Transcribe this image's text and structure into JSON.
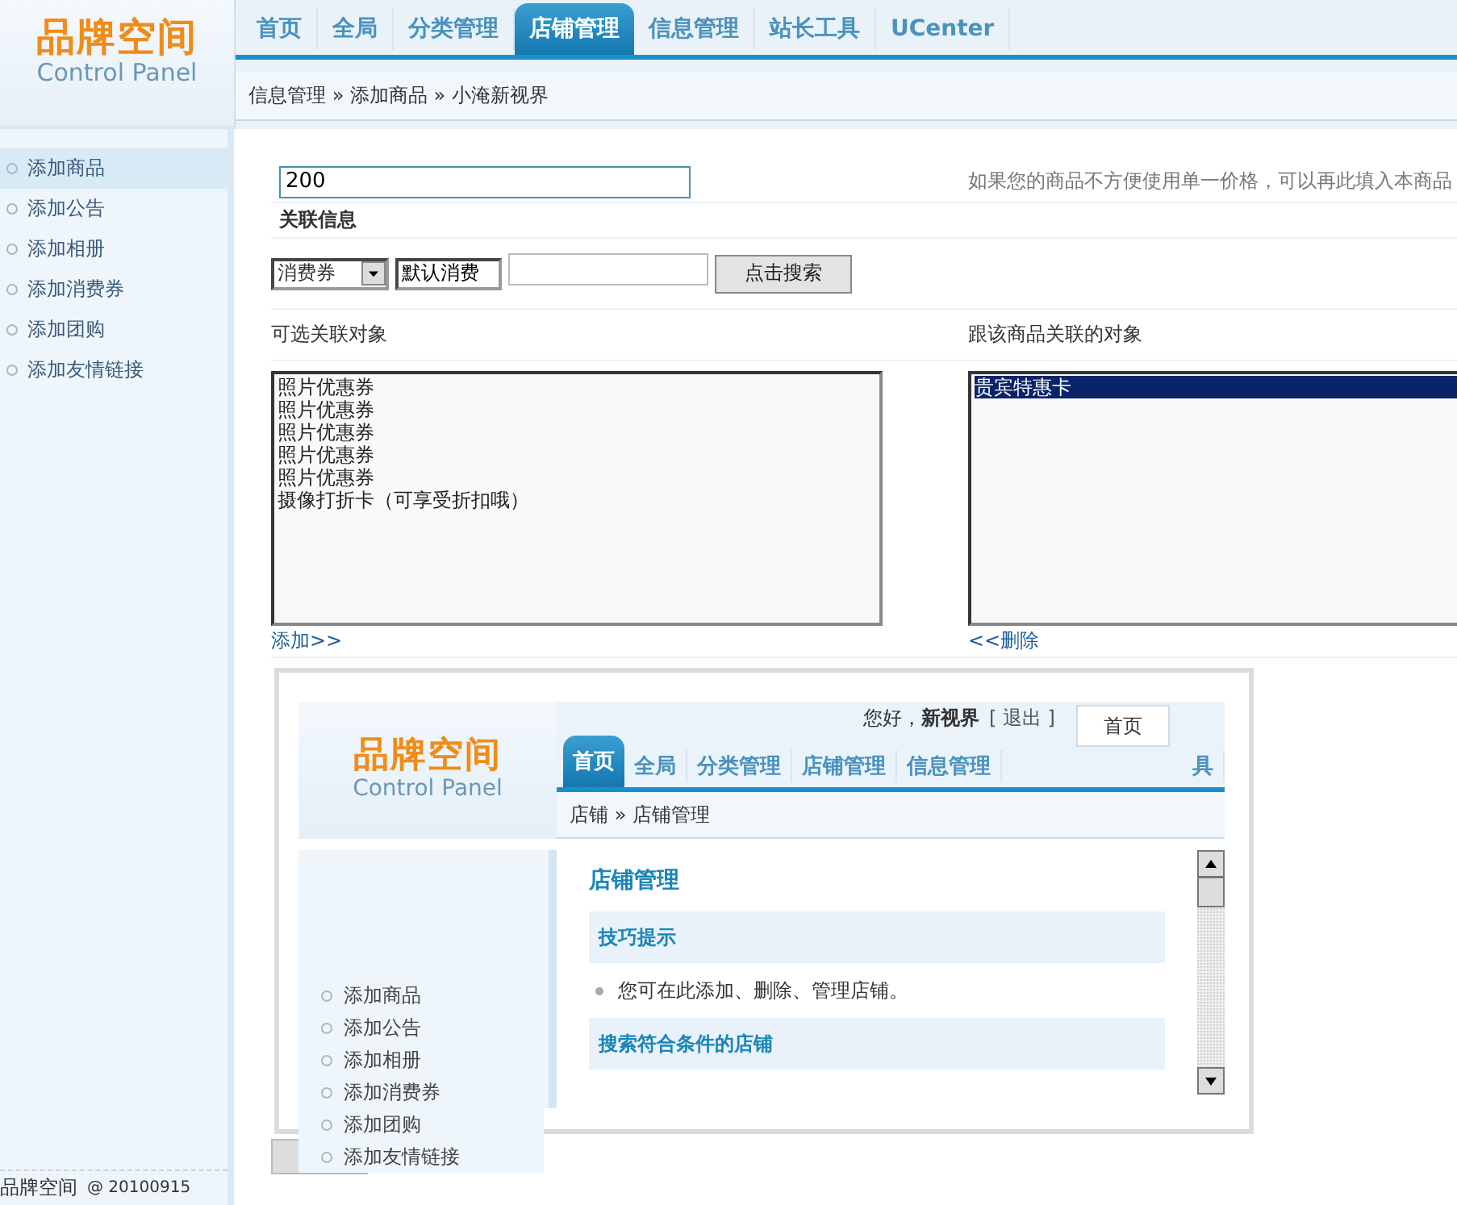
{
  "logo": {
    "title": "品牌空间",
    "subtitle": "Control Panel"
  },
  "nav_tabs": [
    {
      "label": "首页",
      "selected": false
    },
    {
      "label": "全局",
      "selected": false
    },
    {
      "label": "分类管理",
      "selected": false
    },
    {
      "label": "店铺管理",
      "selected": true
    },
    {
      "label": "信息管理",
      "selected": false
    },
    {
      "label": "站长工具",
      "selected": false
    },
    {
      "label": "UCenter",
      "selected": false
    }
  ],
  "breadcrumb": "信息管理 » 添加商品 » 小淹新视界",
  "sidebar": {
    "items": [
      {
        "label": "添加商品",
        "selected": true
      },
      {
        "label": "添加公告",
        "selected": false
      },
      {
        "label": "添加相册",
        "selected": false
      },
      {
        "label": "添加消费券",
        "selected": false
      },
      {
        "label": "添加团购",
        "selected": false
      },
      {
        "label": "添加友情链接",
        "selected": false
      }
    ]
  },
  "footer": {
    "brand": "品牌空间",
    "version": "@ 20100915"
  },
  "form": {
    "price_value": "200",
    "price_hint": "如果您的商品不方便使用单一价格，可以再此填入本商品",
    "section_title": "关联信息",
    "type_select": {
      "value": "消费券"
    },
    "search_field": {
      "value": "默认消费"
    },
    "search_button": "点击搜索",
    "available_label": "可选关联对象",
    "linked_label": "跟该商品关联的对象",
    "available_items": [
      {
        "label": "照片优惠券",
        "selected": false
      },
      {
        "label": "照片优惠券",
        "selected": false
      },
      {
        "label": "照片优惠券",
        "selected": false
      },
      {
        "label": "照片优惠券",
        "selected": false
      },
      {
        "label": "照片优惠券",
        "selected": false
      },
      {
        "label": "摄像打折卡（可享受折扣哦）",
        "selected": false
      }
    ],
    "linked_items": [
      {
        "label": "贵宾特惠卡",
        "selected": true
      }
    ],
    "add_link": "添加>>",
    "remove_link": "<<删除"
  },
  "preview": {
    "logo": {
      "title": "品牌空间",
      "subtitle": "Control Panel"
    },
    "tabs": [
      {
        "label": "首页",
        "selected": true
      },
      {
        "label": "全局",
        "selected": false
      },
      {
        "label": "分类管理",
        "selected": false
      },
      {
        "label": "店铺管理",
        "selected": false
      },
      {
        "label": "信息管理",
        "selected": false
      },
      {
        "label": "具",
        "selected": false
      }
    ],
    "greeting": "您好，**新视界**",
    "logout": "[ 退出 ]",
    "home_box": "首页",
    "breadcrumb": "店铺 » 店铺管理",
    "title": "店铺管理",
    "sections": [
      {
        "title": "技巧提示",
        "bullets": [
          "您可在此添加、删除、管理店铺。"
        ]
      },
      {
        "title": "搜索符合条件的店铺"
      }
    ],
    "sidebar_items": [
      {
        "label": "添加商品"
      },
      {
        "label": "添加公告"
      },
      {
        "label": "添加相册"
      },
      {
        "label": "添加消费券"
      },
      {
        "label": "添加团购"
      },
      {
        "label": "添加友情链接"
      }
    ]
  }
}
